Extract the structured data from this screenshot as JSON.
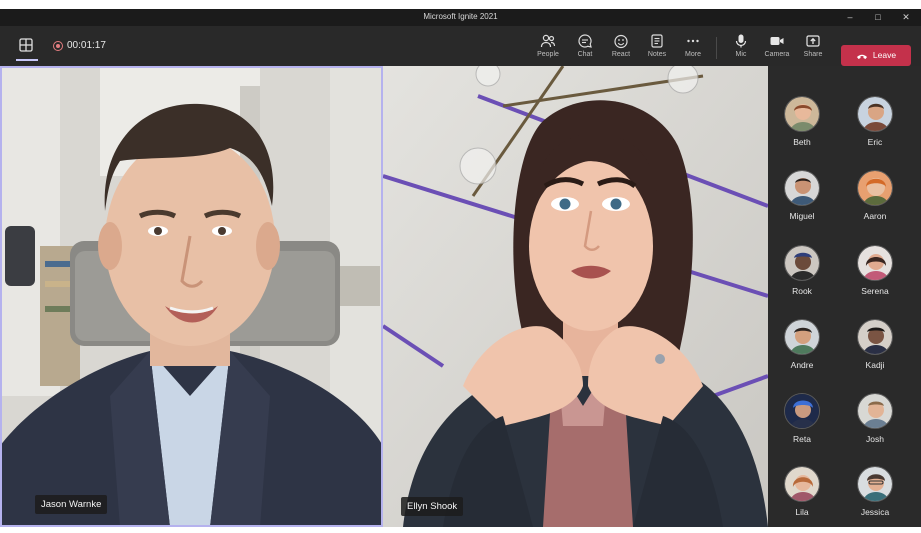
{
  "window": {
    "title": "Microsoft Ignite 2021"
  },
  "toolbar": {
    "timer": "00:01:17",
    "buttons": [
      {
        "id": "people",
        "label": "People",
        "icon": "people-icon"
      },
      {
        "id": "chat",
        "label": "Chat",
        "icon": "chat-icon"
      },
      {
        "id": "react",
        "label": "React",
        "icon": "react-icon"
      },
      {
        "id": "notes",
        "label": "Notes",
        "icon": "notes-icon"
      },
      {
        "id": "more",
        "label": "More",
        "icon": "more-icon"
      },
      {
        "id": "mic",
        "label": "Mic",
        "icon": "mic-icon"
      },
      {
        "id": "camera",
        "label": "Camera",
        "icon": "camera-icon"
      },
      {
        "id": "share",
        "label": "Share",
        "icon": "share-icon"
      }
    ],
    "leave_label": "Leave"
  },
  "videos": [
    {
      "name": "Jason Warnke"
    },
    {
      "name": "Ellyn Shook"
    }
  ],
  "participants": [
    {
      "name": "Beth"
    },
    {
      "name": "Eric"
    },
    {
      "name": "Miguel"
    },
    {
      "name": "Aaron"
    },
    {
      "name": "Rook"
    },
    {
      "name": "Serena"
    },
    {
      "name": "Andre"
    },
    {
      "name": "Kadji"
    },
    {
      "name": "Reta"
    },
    {
      "name": "Josh"
    },
    {
      "name": "Lila"
    },
    {
      "name": "Jessica"
    }
  ],
  "colors": {
    "leave": "#c4314b",
    "speaker_border": "#b5b2ee",
    "recording": "#e37d80"
  }
}
